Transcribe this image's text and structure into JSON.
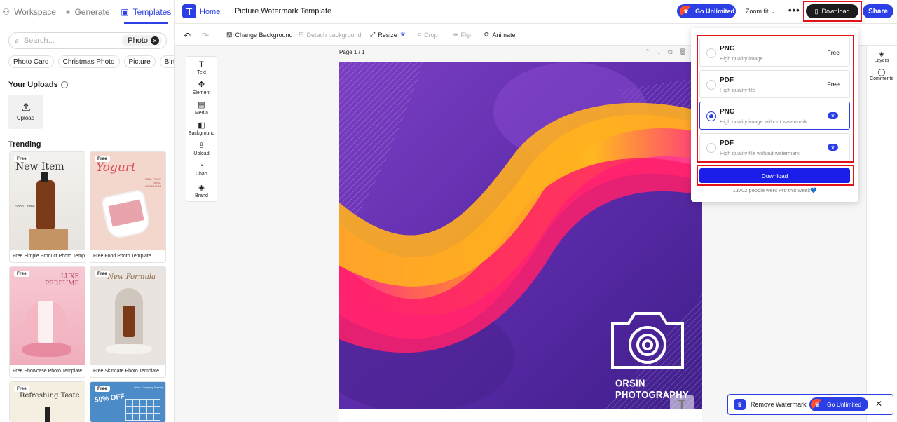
{
  "left_panel": {
    "tabs": [
      {
        "label": "Workspace",
        "icon": "workspace-icon"
      },
      {
        "label": "Generate",
        "icon": "plus-icon"
      },
      {
        "label": "Templates",
        "icon": "templates-icon"
      }
    ],
    "search": {
      "placeholder": "Search...",
      "chip": "Photo"
    },
    "chips": [
      "Photo Card",
      "Christmas Photo",
      "Picture",
      "Birthday Ph"
    ],
    "uploads_title": "Your Uploads",
    "upload_label": "Upload",
    "trending_title": "Trending",
    "cards": [
      {
        "badge": "Free",
        "caption": "Free Simple Product Photo Temp...",
        "thumb_title": "New Item",
        "thumb_sub": "Shop Online"
      },
      {
        "badge": "Free",
        "caption": "Free Food Photo Template",
        "thumb_title": "Yogurt",
        "thumb_sub": "REAL FRUIT REAL GOODNESS"
      },
      {
        "badge": "Free",
        "caption": "Free Showcase Photo Template",
        "thumb_title": "LUXE PERFUME",
        "thumb_sub": ""
      },
      {
        "badge": "Free",
        "caption": "Free Skincare Photo Template",
        "thumb_title": "New Formula",
        "thumb_sub": ""
      },
      {
        "badge": "Free",
        "caption": "",
        "thumb_title": "Refreshing Taste",
        "thumb_sub": ""
      },
      {
        "badge": "Free",
        "caption": "",
        "thumb_title": "50% OFF",
        "thumb_sub": "(Your Company Name)"
      }
    ]
  },
  "header": {
    "logo": "T",
    "home": "Home",
    "doc_title": "Picture Watermark Template",
    "go_unlimited": "Go Unlimited",
    "zoom": "Zoom fit",
    "more": "•••",
    "download": "Download",
    "share": "Share"
  },
  "toolbar": {
    "change_background": "Change Background",
    "detach_background": "Detach background",
    "resize": "Resize",
    "crop": "Crop",
    "flip": "Flip",
    "animate": "Animate"
  },
  "side_tools": [
    "Text",
    "Element",
    "Media",
    "Background",
    "Upload",
    "Chart",
    "Brand"
  ],
  "canvas": {
    "page_label": "Page 1 / 1",
    "watermark_text": "ORSIN PHOTOGRAPHY",
    "corner_logo": "T",
    "colors": {
      "purple": "#6a2fb6",
      "orange": "#ff9a1f",
      "pink": "#ff2d7a"
    }
  },
  "right_rail": [
    "Layers",
    "Comments"
  ],
  "download_panel": {
    "options": [
      {
        "format": "PNG",
        "desc": "High quality image",
        "tag": "Free",
        "pro": false,
        "selected": false
      },
      {
        "format": "PDF",
        "desc": "High quality file",
        "tag": "Free",
        "pro": false,
        "selected": false
      },
      {
        "format": "PNG",
        "desc": "High quality image without watermark",
        "tag": "",
        "pro": true,
        "selected": true
      },
      {
        "format": "PDF",
        "desc": "High quality file without watermark",
        "tag": "",
        "pro": true,
        "selected": false
      }
    ],
    "button": "Download",
    "note": "13702 people went Pro this week💙"
  },
  "watermark_bar": {
    "label": "Remove Watermark",
    "go_unlimited": "Go Unlimited"
  },
  "colors": {
    "accent": "#2b3fe4",
    "highlight": "#e0131b",
    "dark": "#1c1c1c"
  }
}
